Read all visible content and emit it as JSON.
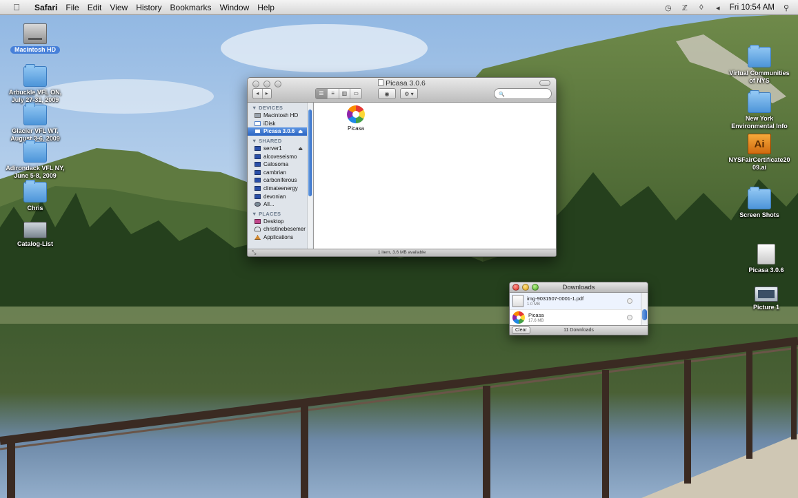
{
  "menubar": {
    "apple_icon": "apple-icon",
    "app_name": "Safari",
    "items": [
      "File",
      "Edit",
      "View",
      "History",
      "Bookmarks",
      "Window",
      "Help"
    ],
    "status": {
      "clock": "Fri 10:54 AM",
      "icons": [
        "time-machine-icon",
        "bluetooth-icon",
        "wifi-icon",
        "volume-icon",
        "spotlight-icon"
      ]
    }
  },
  "desktop_left": [
    {
      "label": "Macintosh HD",
      "icon": "hard-drive-icon",
      "selected": true
    },
    {
      "label": "Arbuckle VFL ON, July 27-31, 2009",
      "icon": "folder-icon"
    },
    {
      "label": "Glacier VFL WT, August 3-6, 2009",
      "icon": "folder-icon"
    },
    {
      "label": "Adirondack VFL NY, June 5-8, 2009",
      "icon": "folder-icon"
    },
    {
      "label": "Chris",
      "icon": "folder-icon"
    },
    {
      "label": "Catalog-List",
      "icon": "document-icon"
    }
  ],
  "desktop_right": [
    {
      "label": "Virtual Communities of NYS",
      "icon": "folder-icon"
    },
    {
      "label": "New York Environmental Info",
      "icon": "folder-icon"
    },
    {
      "label": "NYSFairCertificate2009.ai",
      "icon": "illustrator-file-icon"
    },
    {
      "label": "Screen Shots",
      "icon": "folder-icon"
    },
    {
      "label": "Picasa 3.0.6",
      "icon": "disk-image-icon"
    },
    {
      "label": "Picture 1",
      "icon": "picture-icon"
    }
  ],
  "finder": {
    "title": "Picasa 3.0.6",
    "toolbar": {
      "back": "◂",
      "forward": "▸",
      "view_modes": [
        "☰",
        "≡",
        "▥",
        "▭"
      ],
      "quicklook": "◉",
      "action": "⚙ ▾",
      "search_glyph": "🔍"
    },
    "sidebar": {
      "devices_head": "▼ DEVICES",
      "devices": [
        {
          "label": "Macintosh HD",
          "icon": "hd"
        },
        {
          "label": "iDisk",
          "icon": "disk"
        },
        {
          "label": "Picasa 3.0.6",
          "icon": "disk",
          "selected": true,
          "eject": "⏏"
        }
      ],
      "shared_head": "▼ SHARED",
      "shared": [
        {
          "label": "server1",
          "icon": "mon",
          "eject": "⏏"
        },
        {
          "label": "alcoveseismo",
          "icon": "mon"
        },
        {
          "label": "Calosoma",
          "icon": "mon"
        },
        {
          "label": "cambrian",
          "icon": "mon"
        },
        {
          "label": "carboniferous",
          "icon": "mon"
        },
        {
          "label": "climateenergy",
          "icon": "mon"
        },
        {
          "label": "devonian",
          "icon": "mon"
        },
        {
          "label": "All...",
          "icon": "net"
        }
      ],
      "places_head": "▼ PLACES",
      "places": [
        {
          "label": "Desktop",
          "icon": "desk"
        },
        {
          "label": "christinebesemer",
          "icon": "home"
        },
        {
          "label": "Applications",
          "icon": "apps"
        }
      ]
    },
    "content": {
      "file_name": "Picasa"
    },
    "status_text": "1 item, 3.6 MB available",
    "resize_glyph": "⤡"
  },
  "downloads": {
    "title": "Downloads",
    "items": [
      {
        "name": "img-9031507-0001-1.pdf",
        "size": "1.0 MB",
        "icon": "pdf"
      },
      {
        "name": "Picasa",
        "size": "17.6 MB",
        "icon": "pic"
      }
    ],
    "clear_label": "Clear",
    "count_label": "11 Downloads"
  },
  "colors": {
    "selection_blue": "#2a64c2",
    "sidebar_bg": "#dfe4ea",
    "sky": "#b7d3ee",
    "forest": "#2e4a24"
  }
}
